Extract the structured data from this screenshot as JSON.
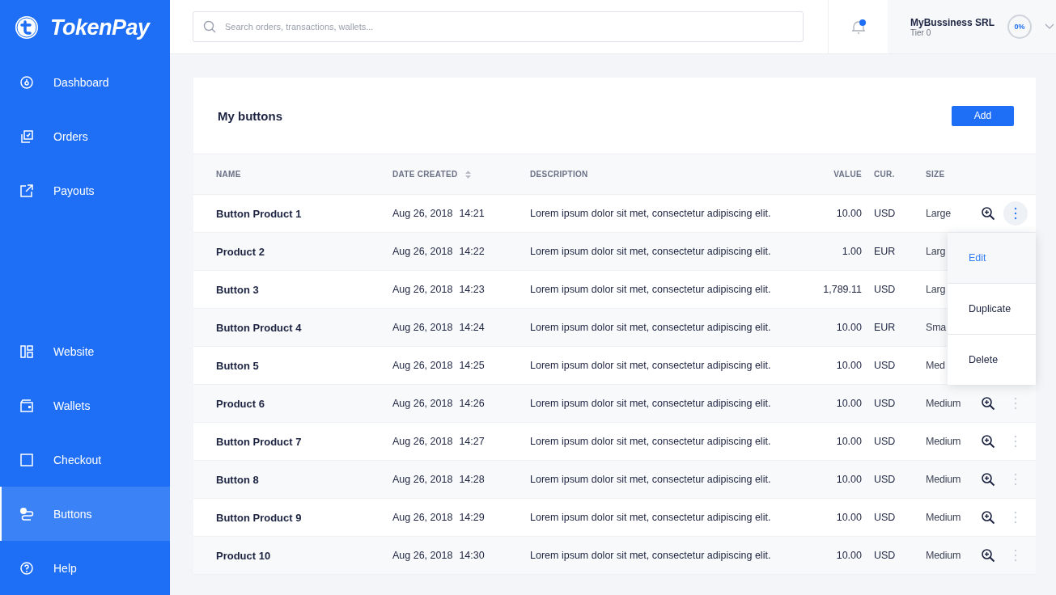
{
  "brand": {
    "name": "TokenPay"
  },
  "sidebar": {
    "main_items": [
      {
        "label": "Dashboard",
        "selected": false
      },
      {
        "label": "Orders",
        "selected": false
      },
      {
        "label": "Payouts",
        "selected": false
      }
    ],
    "bottom_items": [
      {
        "label": "Website",
        "selected": false
      },
      {
        "label": "Wallets",
        "selected": false
      },
      {
        "label": "Checkout",
        "selected": false
      },
      {
        "label": "Buttons",
        "selected": true
      },
      {
        "label": "Help",
        "selected": false
      }
    ]
  },
  "topbar": {
    "search": {
      "placeholder": "Search orders, transactions, wallets..."
    },
    "notifications": {
      "unread": true
    },
    "account": {
      "name": "MyBussiness SRL",
      "tier": "Tier 0",
      "progress": "0%"
    }
  },
  "card": {
    "title": "My buttons",
    "add_button": "Add",
    "columns": [
      {
        "label": "NAME",
        "sortable": false
      },
      {
        "label": "DATE CREATED",
        "sortable": true
      },
      {
        "label": "DESCRIPTION",
        "sortable": false
      },
      {
        "label": "VALUE",
        "sortable": false
      },
      {
        "label": "CUR.",
        "sortable": false
      },
      {
        "label": "SIZE",
        "sortable": false
      }
    ],
    "rows": [
      {
        "name": "Button Product 1",
        "date": "Aug 26, 2018",
        "time": "14:21",
        "description": "Lorem ipsum dolor sit met, consectetur adipiscing elit.",
        "value": "10.00",
        "currency": "USD",
        "size": "Large",
        "actions": true,
        "menu_open": true
      },
      {
        "name": "Product 2",
        "date": "Aug 26, 2018",
        "time": "14:22",
        "description": "Lorem ipsum dolor sit met, consectetur adipiscing elit.",
        "value": "1.00",
        "currency": "EUR",
        "size": "Larg",
        "actions": false,
        "menu_open": false
      },
      {
        "name": "Button 3",
        "date": "Aug 26, 2018",
        "time": "14:23",
        "description": "Lorem ipsum dolor sit met, consectetur adipiscing elit.",
        "value": "1,789.11",
        "currency": "USD",
        "size": "Larg",
        "actions": false,
        "menu_open": false
      },
      {
        "name": "Button Product 4",
        "date": "Aug 26, 2018",
        "time": "14:24",
        "description": "Lorem ipsum dolor sit met, consectetur adipiscing elit.",
        "value": "10.00",
        "currency": "EUR",
        "size": "Sma",
        "actions": false,
        "menu_open": false
      },
      {
        "name": "Button 5",
        "date": "Aug 26, 2018",
        "time": "14:25",
        "description": "Lorem ipsum dolor sit met, consectetur adipiscing elit.",
        "value": "10.00",
        "currency": "USD",
        "size": "Med",
        "actions": false,
        "menu_open": false
      },
      {
        "name": "Product 6",
        "date": "Aug 26, 2018",
        "time": "14:26",
        "description": "Lorem ipsum dolor sit met, consectetur adipiscing elit.",
        "value": "10.00",
        "currency": "USD",
        "size": "Medium",
        "actions": true,
        "menu_open": false
      },
      {
        "name": "Button Product 7",
        "date": "Aug 26, 2018",
        "time": "14:27",
        "description": "Lorem ipsum dolor sit met, consectetur adipiscing elit.",
        "value": "10.00",
        "currency": "USD",
        "size": "Medium",
        "actions": true,
        "menu_open": false
      },
      {
        "name": "Button 8",
        "date": "Aug 26, 2018",
        "time": "14:28",
        "description": "Lorem ipsum dolor sit met, consectetur adipiscing elit.",
        "value": "10.00",
        "currency": "USD",
        "size": "Medium",
        "actions": true,
        "menu_open": false
      },
      {
        "name": "Button Product 9",
        "date": "Aug 26, 2018",
        "time": "14:29",
        "description": "Lorem ipsum dolor sit met, consectetur adipiscing elit.",
        "value": "10.00",
        "currency": "USD",
        "size": "Medium",
        "actions": true,
        "menu_open": false
      },
      {
        "name": "Product 10",
        "date": "Aug 26, 2018",
        "time": "14:30",
        "description": "Lorem ipsum dolor sit met, consectetur adipiscing elit.",
        "value": "10.00",
        "currency": "USD",
        "size": "Medium",
        "actions": true,
        "menu_open": false
      }
    ],
    "row_menu": [
      {
        "label": "Edit",
        "selected": true
      },
      {
        "label": "Duplicate",
        "selected": false
      },
      {
        "label": "Delete",
        "selected": false
      }
    ]
  }
}
